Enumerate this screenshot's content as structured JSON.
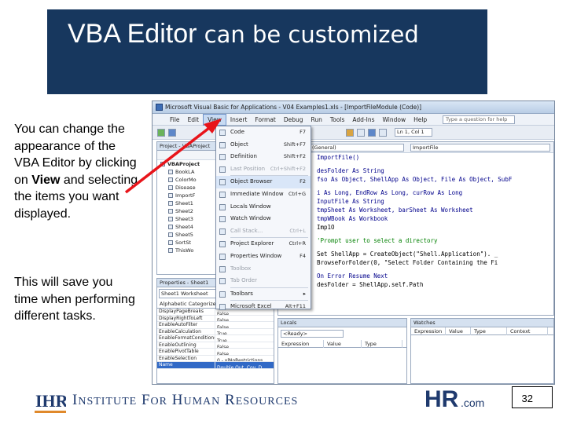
{
  "slide": {
    "title_part1": "VBA Editor",
    "title_part2": " can be customized",
    "para1_text1": "You can change the appearance of the VBA Editor by clicking on ",
    "para1_bold": "View",
    "para1_text2": " and selecting the items you want displayed.",
    "para2": "This will save you time when performing different tasks.",
    "page_number": "32",
    "accent_color": "#17375e",
    "arrow_color": "#e8141a"
  },
  "footer": {
    "org_name": {
      "w1_cap": "I",
      "w1_rest": "NSTITUTE",
      "w2_cap": "F",
      "w2_rest": "OR",
      "w3_cap": "H",
      "w3_rest": "UMAN",
      "w4_cap": "R",
      "w4_rest": "ESOURCES"
    },
    "ihr_logo_text": "IHR",
    "hr_logo_text": "HR",
    "hr_logo_suffix": ".com"
  },
  "vbe": {
    "window_title": "Microsoft Visual Basic for Applications - V04 Examples1.xls - [ImportFileModule (Code)]",
    "menu": [
      "File",
      "Edit",
      "View",
      "Insert",
      "Format",
      "Debug",
      "Run",
      "Tools",
      "Add-Ins",
      "Window",
      "Help"
    ],
    "help_placeholder": "Type a question for help",
    "position": "Ln 1, Col 1",
    "project_pane_title": "Project - VBAProject",
    "project_root": "VBAProject",
    "project_items": [
      "BookLA",
      "ColorMo",
      "Disease",
      "ImportF",
      "Sheet1",
      "Sheet2",
      "Sheet3",
      "Sheet4",
      "Sheet5",
      "SortSt",
      "ThisWo"
    ],
    "properties_title": "Properties - Sheet1",
    "properties_combo": "Sheet1 Worksheet",
    "properties_tabs": "Alphabetic  Categorized",
    "properties_rows": [
      {
        "name": "DisplayPageBreaks",
        "value": "False"
      },
      {
        "name": "DisplayRightToLeft",
        "value": "False"
      },
      {
        "name": "EnableAutoFilter",
        "value": "False"
      },
      {
        "name": "EnableCalculation",
        "value": "True"
      },
      {
        "name": "EnableFormatConditionsCalculation",
        "value": "True"
      },
      {
        "name": "EnableOutlining",
        "value": "False"
      },
      {
        "name": "EnablePivotTable",
        "value": "False"
      },
      {
        "name": "EnableSelection",
        "value": "0 - xlNoRestrictions"
      },
      {
        "name": "Name",
        "value": "Double Out. Cov. D"
      }
    ],
    "code_combo_left": "(General)",
    "code_combo_right": "ImportFile",
    "code_lines": [
      {
        "t": "ImportFile()",
        "c": "kw"
      },
      {
        "t": "",
        "c": "gap"
      },
      {
        "t": "desFolder As String",
        "c": "kw"
      },
      {
        "t": "fso As Object, ShellApp As Object, File As Object, SubF",
        "c": "kw"
      },
      {
        "t": "",
        "c": "gap"
      },
      {
        "t": "i As Long, EndRow As Long, curRow As Long",
        "c": "kw"
      },
      {
        "t": "InputFile As String",
        "c": "kw"
      },
      {
        "t": "tmpSheet As Worksheet, barSheet As Worksheet",
        "c": "kw"
      },
      {
        "t": "tmpWBook As Workbook",
        "c": "kw"
      },
      {
        "t": "Imp1O",
        "c": ""
      },
      {
        "t": "",
        "c": "gap"
      },
      {
        "t": "'Prompt user to select a directory",
        "c": "cm"
      },
      {
        "t": "",
        "c": "gap"
      },
      {
        "t": "Set ShellApp = CreateObject(\"Shell.Application\"). _",
        "c": ""
      },
      {
        "t": "BrowseForFolder(0, \"Select Folder Containing the Fi",
        "c": ""
      },
      {
        "t": "",
        "c": "gap"
      },
      {
        "t": "On Error Resume Next",
        "c": "kw"
      },
      {
        "t": "desFolder = ShellApp.self.Path",
        "c": ""
      }
    ],
    "locals_title": "Locals",
    "locals_ready": "<Ready>",
    "locals_cols": [
      "Expression",
      "Value",
      "Type"
    ],
    "watches_title": "Watches",
    "watches_cols": [
      "Expression",
      "Value",
      "Type",
      "Context"
    ],
    "view_menu": [
      {
        "label": "Code",
        "shortcut": "F7",
        "disabled": false
      },
      {
        "label": "Object",
        "shortcut": "Shift+F7",
        "disabled": false
      },
      {
        "label": "Definition",
        "shortcut": "Shift+F2",
        "disabled": false
      },
      {
        "label": "Last Position",
        "shortcut": "Ctrl+Shift+F2",
        "disabled": true
      },
      {
        "sep": true
      },
      {
        "label": "Object Browser",
        "shortcut": "F2",
        "disabled": false,
        "hl": true
      },
      {
        "label": "Immediate Window",
        "shortcut": "Ctrl+G",
        "disabled": false
      },
      {
        "label": "Locals Window",
        "shortcut": "",
        "disabled": false
      },
      {
        "label": "Watch Window",
        "shortcut": "",
        "disabled": false
      },
      {
        "label": "Call Stack...",
        "shortcut": "Ctrl+L",
        "disabled": true
      },
      {
        "sep": true
      },
      {
        "label": "Project Explorer",
        "shortcut": "Ctrl+R",
        "disabled": false
      },
      {
        "label": "Properties Window",
        "shortcut": "F4",
        "disabled": false
      },
      {
        "label": "Toolbox",
        "shortcut": "",
        "disabled": true
      },
      {
        "label": "Tab Order",
        "shortcut": "",
        "disabled": true
      },
      {
        "sep": true
      },
      {
        "label": "Toolbars",
        "shortcut": "▸",
        "disabled": false
      },
      {
        "sep": true
      },
      {
        "label": "Microsoft Excel",
        "shortcut": "Alt+F11",
        "disabled": false
      }
    ]
  }
}
